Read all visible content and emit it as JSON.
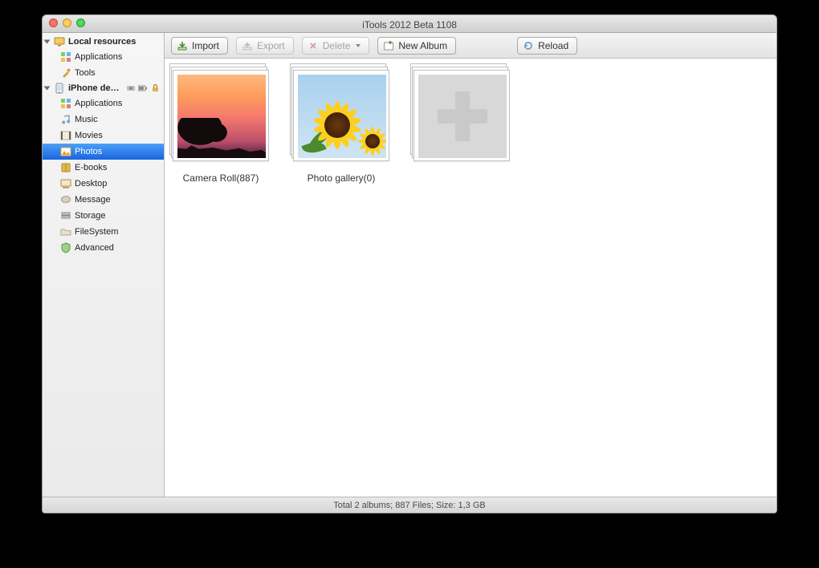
{
  "window": {
    "title": "iTools 2012 Beta 1108"
  },
  "sidebar": {
    "group1": {
      "label": "Local resources",
      "items": [
        {
          "label": "Applications"
        },
        {
          "label": "Tools"
        }
      ]
    },
    "group2": {
      "label": "iPhone de…",
      "items": [
        {
          "label": "Applications"
        },
        {
          "label": "Music"
        },
        {
          "label": "Movies"
        },
        {
          "label": "Photos"
        },
        {
          "label": "E-books"
        },
        {
          "label": "Desktop"
        },
        {
          "label": "Message"
        },
        {
          "label": "Storage"
        },
        {
          "label": "FileSystem"
        },
        {
          "label": "Advanced"
        }
      ]
    }
  },
  "toolbar": {
    "import": "Import",
    "export": "Export",
    "delete": "Delete",
    "new_album": "New Album",
    "reload": "Reload"
  },
  "albums": [
    {
      "label": "Camera Roll(887)"
    },
    {
      "label": "Photo gallery(0)"
    }
  ],
  "statusbar": {
    "text": "Total 2 albums; 887 Files;  Size: 1,3 GB"
  }
}
